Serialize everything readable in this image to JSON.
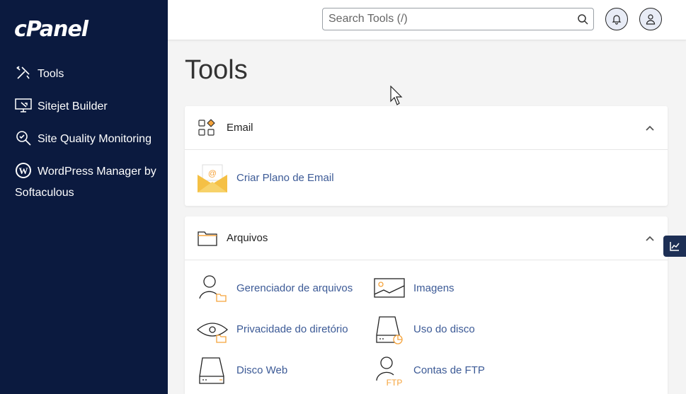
{
  "sidebar": {
    "logo": "cPanel",
    "items": [
      {
        "label": "Tools",
        "icon": "tools-icon"
      },
      {
        "label": "Sitejet Builder",
        "icon": "sitejet-monitor-icon"
      },
      {
        "label": "Site Quality Monitoring",
        "icon": "site-quality-magnifier-icon"
      },
      {
        "label": "WordPress Manager by Softaculous",
        "icon": "wordpress-icon"
      }
    ]
  },
  "topbar": {
    "search_placeholder": "Search Tools (/)",
    "search_icon": "search-icon",
    "notifications_icon": "bell-icon",
    "user_icon": "user-icon"
  },
  "main": {
    "title": "Tools",
    "sections": [
      {
        "title": "Email",
        "icon": "email-grid-icon",
        "tools": [
          {
            "label": "Criar Plano de Email",
            "icon": "email-envelope-icon"
          }
        ]
      },
      {
        "title": "Arquivos",
        "icon": "folder-icon",
        "tools": [
          {
            "label": "Gerenciador de arquivos",
            "icon": "file-manager-icon"
          },
          {
            "label": "Imagens",
            "icon": "images-icon"
          },
          {
            "label": "Privacidade do diretório",
            "icon": "directory-privacy-eye-icon"
          },
          {
            "label": "Uso do disco",
            "icon": "disk-usage-icon"
          },
          {
            "label": "Disco Web",
            "icon": "web-disk-icon"
          },
          {
            "label": "Contas de FTP",
            "icon": "ftp-accounts-icon"
          }
        ]
      }
    ]
  },
  "ftp_badge": "FTP",
  "email_at": "@",
  "colors": {
    "sidebar_bg": "#0b1a3f",
    "link": "#3c5a96",
    "accent_orange": "#f5a33b"
  }
}
